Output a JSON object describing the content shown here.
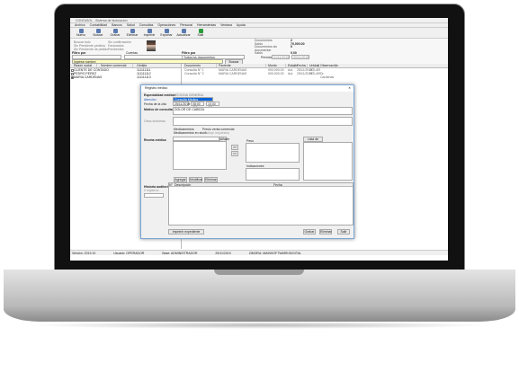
{
  "window": {
    "title": "CONTASOL - Sistema de facturación"
  },
  "menu": [
    "Archivo",
    "Contabilidad",
    "Bancos",
    "Salud",
    "Consultas",
    "Operaciones",
    "Personal",
    "Herramientas",
    "Ventana",
    "Ayuda"
  ],
  "toolbar": [
    "Nuevo",
    "Buscar",
    "Grabar",
    "Eliminar",
    "Imprimir",
    "Exportar",
    "Actualizar",
    "Salir"
  ],
  "filters": {
    "left": [
      "Buscar todo",
      "Sin Pendiente pedidos",
      "Sin Pendiente de pedido"
    ],
    "mid": [
      "Sin confirmación",
      "Facturados",
      "Pendientes"
    ],
    "filter_label": "Filtro por",
    "date_label": "Cuentas",
    "search_placeholder": "Ingrese nombre",
    "search_button": "Buscar clientes"
  },
  "summary": {
    "labels": [
      "Documentos",
      "Saldo",
      "Documentos sin documentar",
      "Saldo"
    ],
    "values": [
      "2",
      "70,000.00",
      "0",
      "0.00"
    ],
    "right_filter": "Filtro por",
    "right_select": "Todos los documentos",
    "period_label": "Período",
    "date_from": "01/11/2019",
    "date_to": "30/11/2019"
  },
  "clients": {
    "columns": [
      "Razón social",
      "Nombre comercial",
      "Cédula"
    ],
    "rows": [
      [
        "CLIENTE DE CONTADO",
        "",
        "0",
        "111111111"
      ],
      [
        "PEDRO PEREZ",
        "",
        "0",
        "111111112"
      ],
      [
        "MARIA CARDENAS",
        "",
        "1",
        "111111113"
      ]
    ]
  },
  "documents": {
    "columns": [
      "Documento",
      "Paciente",
      "Monto",
      "Estado",
      "Fecha",
      "Unidad",
      "Observación"
    ],
    "rows": [
      [
        "Consulta N° 1",
        "MARIA CARDENAS",
        "900,000.00",
        "Act.",
        "25/11/2019",
        "DÓLAR",
        ""
      ],
      [
        "Consulta N° 2",
        "MARIA CARDENAS",
        "900,000.00",
        "Act.",
        "25/11/2019",
        "DÓLAR",
        "Dr. Cardenas"
      ]
    ]
  },
  "dialog": {
    "title": "Registro médico",
    "specialty_label": "Especialidad médica",
    "specialty": "MEDICINA GENERAL",
    "attention_label": "Atención",
    "attention": "Consulta Médica",
    "date_label": "Fecha de la cita",
    "date": "25/11/2019",
    "time1": "08:00 AM",
    "time2": "10:00 AM",
    "reason_label": "Motivo de consulta",
    "reason": "DOLOR DE CABEZA",
    "symptoms_label": "Otros síntomas",
    "recipe_label": "Receta médica",
    "opt1": "Medicamentos",
    "opt2": "Medicamentos en stock",
    "opt3": "Precio venta comercial",
    "opt3_sub": "Incluye impuestos",
    "add_small": "Añadir",
    "weight_label": "Peso",
    "notes_label": "Indicaciones",
    "list_button": "Lista de medicamentos",
    "arrow_right": ">>",
    "arrow_left": "<<",
    "buttons": [
      "Agregar",
      "Modificar",
      "Eliminar"
    ],
    "history_label": "Historia auditoría",
    "history_sub": "0 registros",
    "table_cols": [
      "N°",
      "Descripción",
      "Fecha"
    ],
    "print_button": "Imprimir expediente",
    "save": "Grabar",
    "delete": "Eliminar",
    "exit": "Salir"
  },
  "status": [
    "Versión: 2019.10",
    "Usuario: OPERADOR",
    "Base: ADMINISTRADOR",
    "25/11/2019",
    "ZIMORA: MAINSOFTWARE/DIGITAL"
  ]
}
